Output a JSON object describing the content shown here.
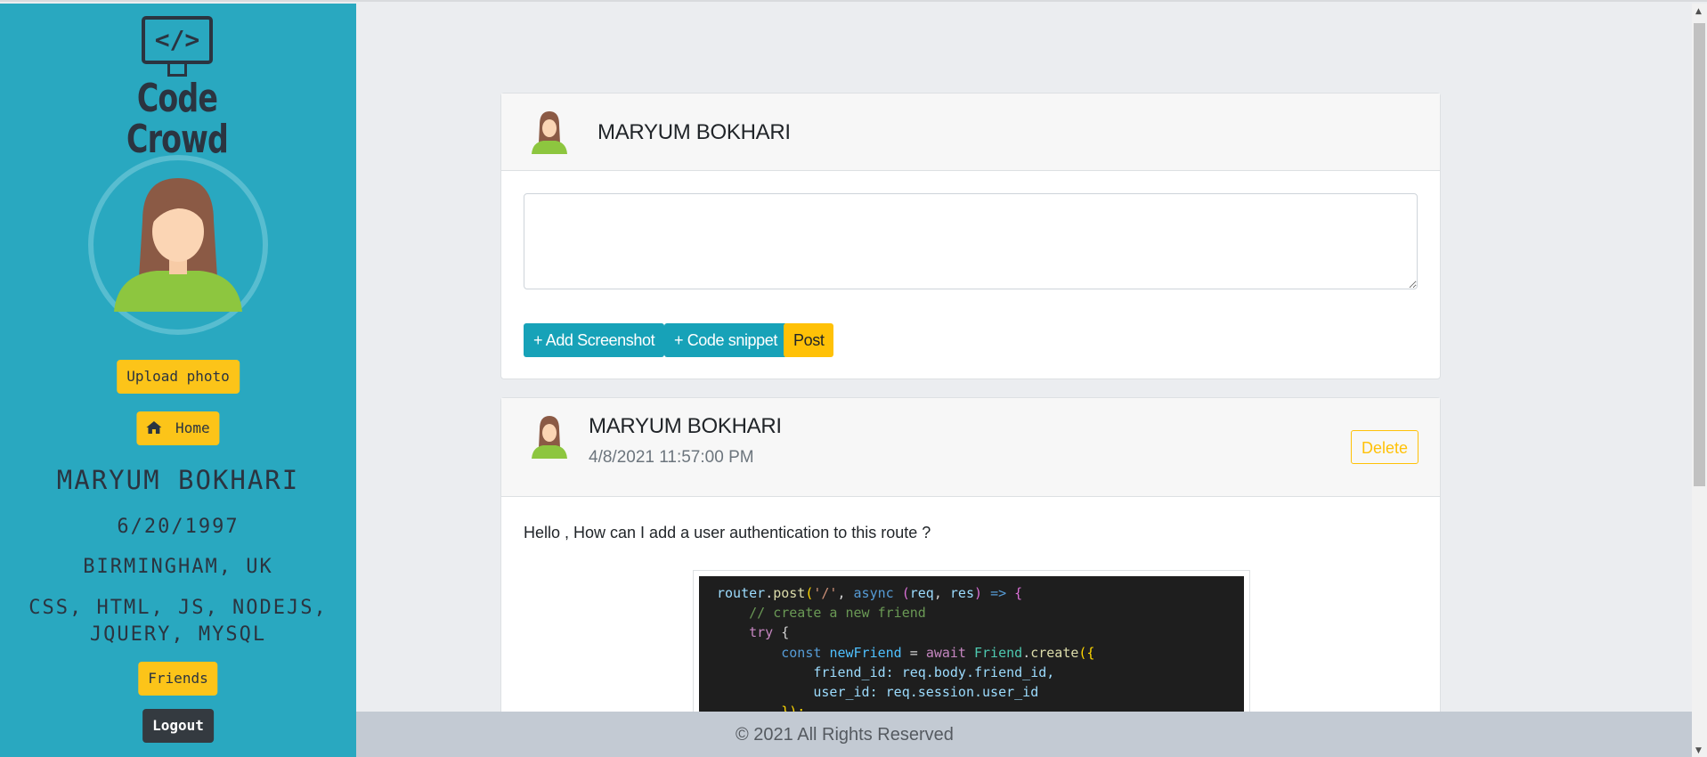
{
  "sidebar": {
    "logo_symbol": "</>",
    "logo_text": "Code Crowd",
    "upload_photo": "Upload photo",
    "home": "Home",
    "name": "MARYUM BOKHARI",
    "dob": "6/20/1997",
    "location": "BIRMINGHAM, UK",
    "skills": "CSS, HTML, JS, NODEJS, JQUERY, MYSQL",
    "friends": "Friends",
    "logout": "Logout"
  },
  "composer": {
    "name": "MARYUM BOKHARI",
    "textarea_placeholder": "",
    "add_screenshot": "+ Add Screenshot",
    "code_snippet": "+ Code snippet",
    "post": "Post"
  },
  "post": {
    "name": "MARYUM BOKHARI",
    "timestamp": "4/8/2021 11:57:00 PM",
    "delete": "Delete",
    "text": "Hello , How can I add a user authentication to this route ?",
    "code_lines": [
      "router.post('/', async (req, res) => {",
      "    // create a new friend",
      "    try {",
      "        const newFriend = await Friend.create({",
      "            friend_id: req.body.friend_id,",
      "            user_id: req.session.user_id",
      "        });"
    ]
  },
  "footer": {
    "text": "© 2021 All Rights Reserved"
  },
  "colors": {
    "sidebar": "#29a8c0",
    "accent": "#ffc107",
    "info": "#17a2b8"
  },
  "icons": [
    "home-icon",
    "avatar-icon"
  ]
}
